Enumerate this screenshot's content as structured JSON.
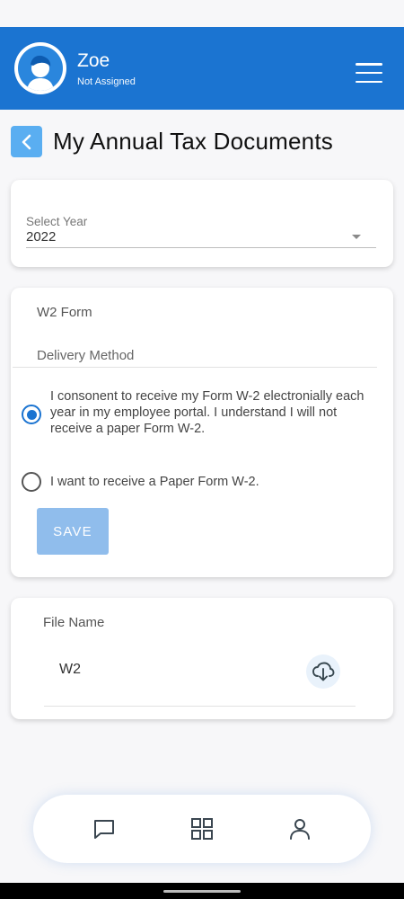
{
  "colors": {
    "brand": "#1b74d1",
    "back_button": "#5aaef1",
    "save_disabled": "#90bdec"
  },
  "header": {
    "user_name": "Zoe",
    "user_status": "Not Assigned",
    "avatar_icon": "user-avatar-icon",
    "menu_icon": "hamburger-menu-icon"
  },
  "page": {
    "title": "My Annual Tax Documents",
    "back_icon": "chevron-left-icon"
  },
  "year_select": {
    "label": "Select Year",
    "value": "2022",
    "dropdown_icon": "caret-down-icon"
  },
  "w2_card": {
    "title": "W2 Form",
    "delivery_label": "Delivery Method",
    "options": [
      {
        "label": "I consonent to receive my Form W-2 electronially each year in my employee portal. I understand I will not receive a paper Form W-2.",
        "selected": true
      },
      {
        "label": "I want to receive a Paper Form W-2.",
        "selected": false
      }
    ],
    "save_label": "SAVE"
  },
  "files": {
    "header": "File Name",
    "rows": [
      {
        "name": "W2",
        "action_icon": "cloud-download-icon"
      }
    ]
  },
  "bottom_nav": {
    "items": [
      {
        "icon": "chat-icon"
      },
      {
        "icon": "grid-icon"
      },
      {
        "icon": "profile-icon"
      }
    ]
  }
}
